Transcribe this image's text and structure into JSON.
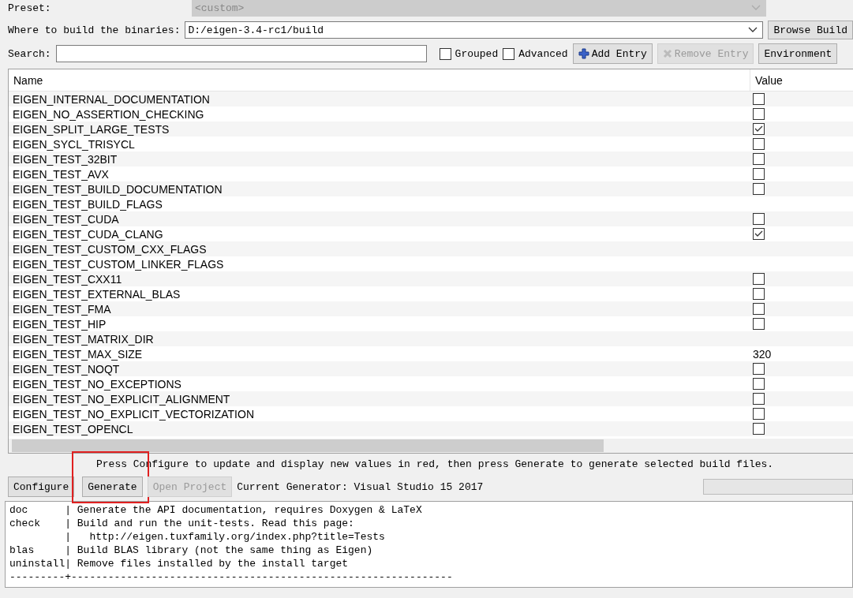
{
  "preset": {
    "label": "Preset:",
    "value": "<custom>"
  },
  "build_dir": {
    "label": "Where to build the binaries:",
    "value": "D:/eigen-3.4-rc1/build",
    "button": "Browse Build"
  },
  "toolbar": {
    "search_label": "Search:",
    "options": [
      {
        "label": "Grouped",
        "checked": false
      },
      {
        "label": "Advanced",
        "checked": false
      }
    ],
    "buttons": [
      {
        "label": "Add Entry",
        "kind": "add",
        "disabled": false
      },
      {
        "label": "Remove Entry",
        "kind": "remove",
        "disabled": true
      },
      {
        "label": "Environment",
        "kind": "plain",
        "disabled": false
      }
    ]
  },
  "table": {
    "columns": [
      "Name",
      "Value"
    ],
    "rows": [
      {
        "name": "EIGEN_INTERNAL_DOCUMENTATION",
        "kind": "bool",
        "checked": false
      },
      {
        "name": "EIGEN_NO_ASSERTION_CHECKING",
        "kind": "bool",
        "checked": false
      },
      {
        "name": "EIGEN_SPLIT_LARGE_TESTS",
        "kind": "bool",
        "checked": true
      },
      {
        "name": "EIGEN_SYCL_TRISYCL",
        "kind": "bool",
        "checked": false
      },
      {
        "name": "EIGEN_TEST_32BIT",
        "kind": "bool",
        "checked": false
      },
      {
        "name": "EIGEN_TEST_AVX",
        "kind": "bool",
        "checked": false
      },
      {
        "name": "EIGEN_TEST_BUILD_DOCUMENTATION",
        "kind": "bool",
        "checked": false
      },
      {
        "name": "EIGEN_TEST_BUILD_FLAGS",
        "kind": "text"
      },
      {
        "name": "EIGEN_TEST_CUDA",
        "kind": "bool",
        "checked": false
      },
      {
        "name": "EIGEN_TEST_CUDA_CLANG",
        "kind": "bool",
        "checked": true
      },
      {
        "name": "EIGEN_TEST_CUSTOM_CXX_FLAGS",
        "kind": "text"
      },
      {
        "name": "EIGEN_TEST_CUSTOM_LINKER_FLAGS",
        "kind": "text"
      },
      {
        "name": "EIGEN_TEST_CXX11",
        "kind": "bool",
        "checked": false
      },
      {
        "name": "EIGEN_TEST_EXTERNAL_BLAS",
        "kind": "bool",
        "checked": false
      },
      {
        "name": "EIGEN_TEST_FMA",
        "kind": "bool",
        "checked": false
      },
      {
        "name": "EIGEN_TEST_HIP",
        "kind": "bool",
        "checked": false
      },
      {
        "name": "EIGEN_TEST_MATRIX_DIR",
        "kind": "text"
      },
      {
        "name": "EIGEN_TEST_MAX_SIZE",
        "kind": "text",
        "value": "320"
      },
      {
        "name": "EIGEN_TEST_NOQT",
        "kind": "bool",
        "checked": false
      },
      {
        "name": "EIGEN_TEST_NO_EXCEPTIONS",
        "kind": "bool",
        "checked": false
      },
      {
        "name": "EIGEN_TEST_NO_EXPLICIT_ALIGNMENT",
        "kind": "bool",
        "checked": false
      },
      {
        "name": "EIGEN_TEST_NO_EXPLICIT_VECTORIZATION",
        "kind": "bool",
        "checked": false
      },
      {
        "name": "EIGEN_TEST_OPENCL",
        "kind": "bool",
        "checked": false
      }
    ]
  },
  "message": "Press Configure to update and display new values in red, then press Generate to generate selected build files.",
  "actions": [
    {
      "label": "Configure",
      "disabled": false,
      "highlighted": false
    },
    {
      "label": "Generate",
      "disabled": false,
      "highlighted": true
    },
    {
      "label": "Open Project",
      "disabled": true,
      "highlighted": false
    }
  ],
  "generator": "Current Generator: Visual Studio 15 2017",
  "progress": {
    "level": 0
  },
  "log": [
    "doc      | Generate the API documentation, requires Doxygen & LaTeX",
    "check    | Build and run the unit-tests. Read this page:",
    "         |   http://eigen.tuxfamily.org/index.php?title=Tests",
    "blas     | Build BLAS library (not the same thing as Eigen)",
    "uninstall| Remove files installed by the install target",
    "---------+--------------------------------------------------------------"
  ]
}
